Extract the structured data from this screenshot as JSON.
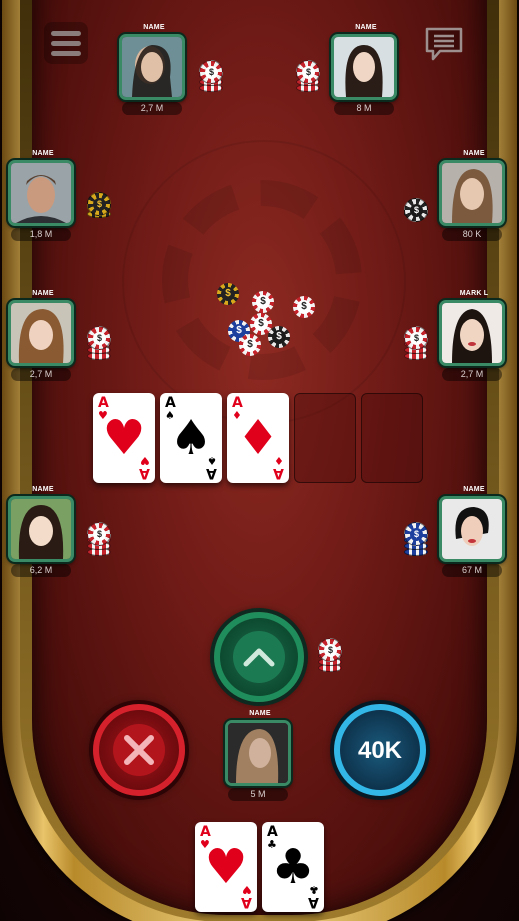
{
  "menu": {
    "icon": "hamburger-menu-icon"
  },
  "chat": {
    "icon": "chat-bubble-icon"
  },
  "players": [
    {
      "id": "top-left",
      "name": "NAME",
      "balance": "2,7 M"
    },
    {
      "id": "top-right",
      "name": "NAME",
      "balance": "8 M"
    },
    {
      "id": "left-1",
      "name": "NAME",
      "balance": "1,8 M"
    },
    {
      "id": "right-1",
      "name": "NAME",
      "balance": "80 K"
    },
    {
      "id": "left-2",
      "name": "NAME",
      "balance": "2,7 M"
    },
    {
      "id": "right-2",
      "name": "MARK L",
      "balance": "2,7 M"
    },
    {
      "id": "left-3",
      "name": "NAME",
      "balance": "6,2 M"
    },
    {
      "id": "right-3",
      "name": "NAME",
      "balance": "67 M"
    }
  ],
  "me": {
    "name": "NAME",
    "balance": "5 M"
  },
  "community_cards": [
    {
      "rank": "A",
      "suit": "♥",
      "color": "red"
    },
    {
      "rank": "A",
      "suit": "♠",
      "color": "black"
    },
    {
      "rank": "A",
      "suit": "♦",
      "color": "red"
    }
  ],
  "hole_cards": [
    {
      "rank": "A",
      "suit": "♥",
      "color": "red"
    },
    {
      "rank": "A",
      "suit": "♣",
      "color": "black"
    }
  ],
  "actions": {
    "fold_icon": "close-x-icon",
    "raise_icon": "chevron-up-icon",
    "bet_label": "40K"
  },
  "colors": {
    "felt": "#7a1f1a",
    "rail": "#d4a845",
    "raise": "#1f8d5c",
    "fold": "#d5212b",
    "bet": "#32b7e7"
  }
}
